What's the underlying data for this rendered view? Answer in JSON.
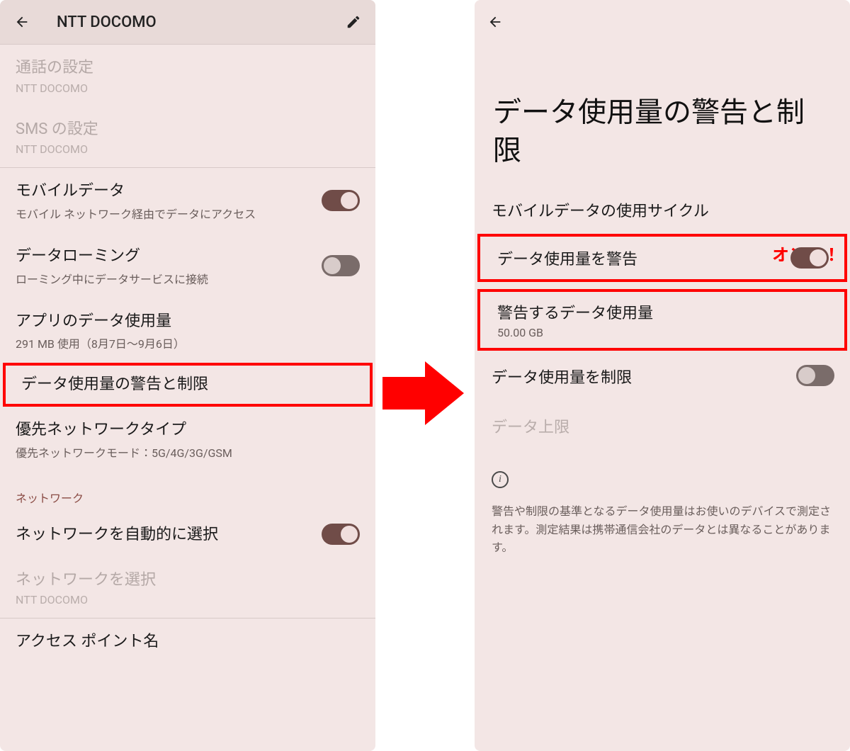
{
  "left": {
    "header_title": "NTT DOCOMO",
    "items": {
      "call_settings": {
        "title": "通話の設定",
        "sub": "NTT DOCOMO"
      },
      "sms_settings": {
        "title": "SMS の設定",
        "sub": "NTT DOCOMO"
      },
      "mobile_data": {
        "title": "モバイルデータ",
        "sub": "モバイル ネットワーク経由でデータにアクセス"
      },
      "data_roaming": {
        "title": "データローミング",
        "sub": "ローミング中にデータサービスに接続"
      },
      "app_data_usage": {
        "title": "アプリのデータ使用量",
        "sub": "291 MB 使用（8月7日～9月6日）"
      },
      "data_warning_limit": {
        "title": "データ使用量の警告と制限"
      },
      "preferred_network_type": {
        "title": "優先ネットワークタイプ",
        "sub": "優先ネットワークモード：5G/4G/3G/GSM"
      },
      "network_category": "ネットワーク",
      "auto_select_network": {
        "title": "ネットワークを自動的に選択"
      },
      "select_network": {
        "title": "ネットワークを選択",
        "sub": "NTT DOCOMO"
      },
      "apn": {
        "title": "アクセス ポイント名"
      }
    }
  },
  "right": {
    "page_title": "データ使用量の警告と制限",
    "annotation": "オンに！",
    "items": {
      "usage_cycle": {
        "title": "モバイルデータの使用サイクル"
      },
      "warn_usage": {
        "title": "データ使用量を警告"
      },
      "warn_amount": {
        "title": "警告するデータ使用量",
        "sub": "50.00 GB"
      },
      "limit_usage": {
        "title": "データ使用量を制限"
      },
      "data_cap": {
        "title": "データ上限"
      }
    },
    "info_text": "警告や制限の基準となるデータ使用量はお使いのデバイスで測定されます。測定結果は携帯通信会社のデータとは異なることがあります。"
  }
}
